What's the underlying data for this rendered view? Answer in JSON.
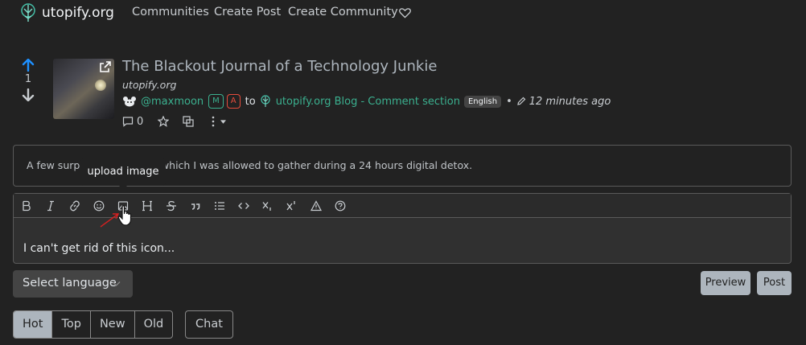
{
  "nav": {
    "site_name": "utopify.org",
    "links": [
      "Communities",
      "Create Post",
      "Create Community"
    ],
    "donate_icon": "heart-icon"
  },
  "post": {
    "score": "1",
    "title": "The Blackout Journal of a Technology Junkie",
    "domain": "utopify.org",
    "author": "@maxmoon",
    "badge_mod": "M",
    "badge_admin": "A",
    "to_word": "to",
    "community": "utopify.org Blog - Comment section",
    "language": "English",
    "dot": "•",
    "time": "12 minutes ago",
    "comment_count": "0",
    "body_before": "A few surpri",
    "body_after": "which I was allowed to gather during a 24 hours digital detox."
  },
  "tooltip": "upload image",
  "editor": {
    "text": "I can't get rid of this icon...",
    "toolbar_icons": [
      "bold-icon",
      "italic-icon",
      "link-icon",
      "emoji-icon",
      "image-icon",
      "header-icon",
      "strikethrough-icon",
      "quote-icon",
      "list-icon",
      "code-icon",
      "subscript-icon",
      "superscript-icon",
      "spoiler-icon",
      "help-icon"
    ]
  },
  "controls": {
    "select_language": "Select language",
    "preview": "Preview",
    "post": "Post"
  },
  "sort": {
    "options": [
      "Hot",
      "Top",
      "New",
      "Old"
    ],
    "active": "Hot",
    "chat": "Chat"
  },
  "colors": {
    "accent": "#3bb08f",
    "upvote": "#1e90ff",
    "admin": "#e74c3c",
    "background": "#222222"
  }
}
